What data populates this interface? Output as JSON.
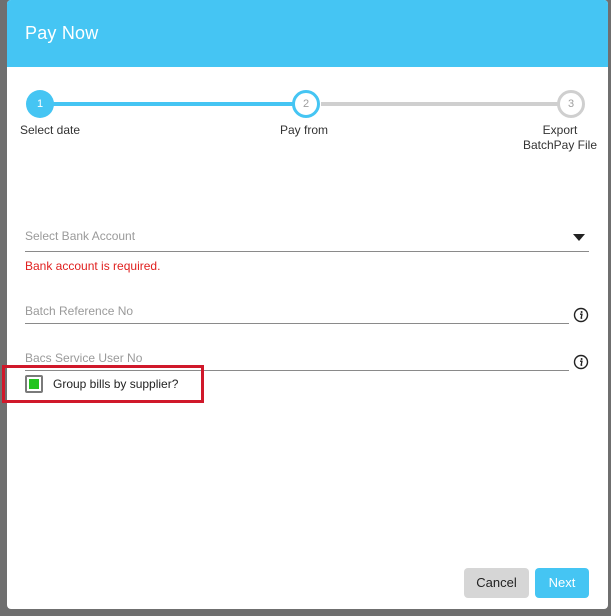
{
  "dialog": {
    "title": "Pay Now"
  },
  "stepper": {
    "steps": [
      {
        "number": "1",
        "label": "Select date",
        "state": "completed"
      },
      {
        "number": "2",
        "label": "Pay from",
        "state": "current"
      },
      {
        "number": "3",
        "label_line1": "Export",
        "label_line2": "BatchPay File",
        "state": "pending"
      }
    ]
  },
  "form": {
    "bank_account": {
      "placeholder": "Select Bank Account",
      "error": "Bank account is required."
    },
    "batch_reference": {
      "placeholder": "Batch Reference No"
    },
    "bacs_user": {
      "placeholder": "Bacs Service User No"
    },
    "group_bills": {
      "label": "Group bills by supplier?",
      "checked": true
    }
  },
  "buttons": {
    "cancel": "Cancel",
    "next": "Next"
  },
  "colors": {
    "accent": "#45c5f3",
    "error": "#e0201f",
    "checkbox_fill": "#22c41f",
    "highlight": "#d0182a"
  },
  "icons": {
    "dropdown": "caret-down-icon",
    "info": "info-icon"
  }
}
